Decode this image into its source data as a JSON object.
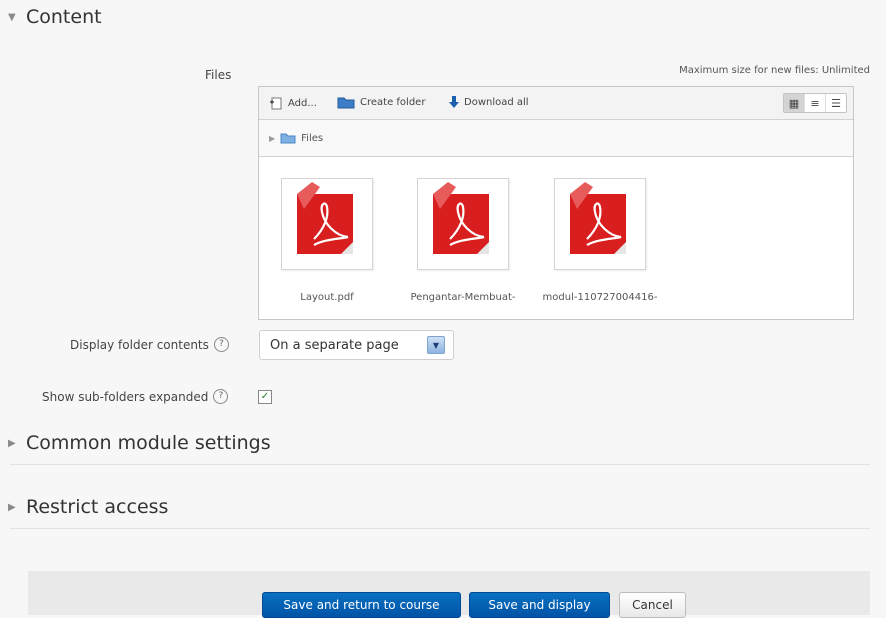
{
  "sections": {
    "content": {
      "label": "Content"
    },
    "common": {
      "label": "Common module settings"
    },
    "restrict": {
      "label": "Restrict access"
    }
  },
  "files": {
    "label": "Files",
    "max_size": "Maximum size for new files: Unlimited",
    "toolbar": {
      "add": "Add...",
      "create_folder": "Create folder",
      "download_all": "Download all"
    },
    "path": "Files",
    "items": [
      {
        "name": "Layout.pdf"
      },
      {
        "name": "Pengantar-Membuat-"
      },
      {
        "name": "modul-110727004416-"
      }
    ]
  },
  "display_folder": {
    "label": "Display folder contents",
    "value": "On a separate page"
  },
  "subfolders": {
    "label": "Show sub-folders expanded",
    "checked": true
  },
  "buttons": {
    "save_return": "Save and return to course",
    "save_display": "Save and display",
    "cancel": "Cancel"
  }
}
